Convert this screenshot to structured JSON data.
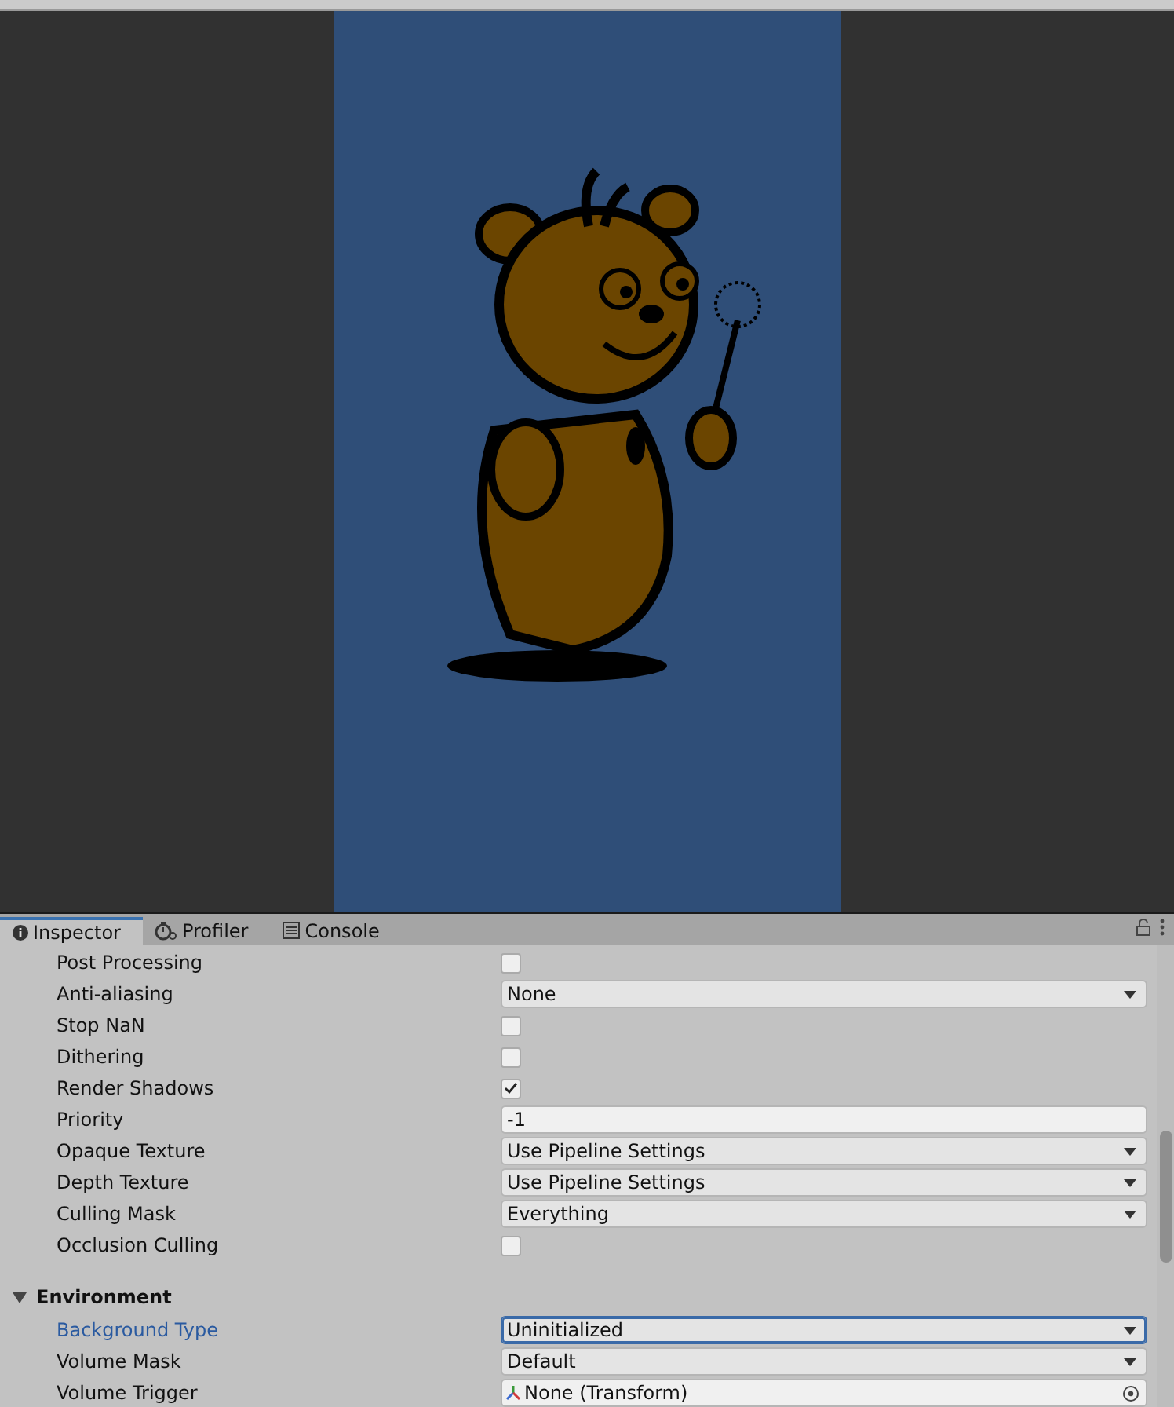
{
  "tabs": [
    {
      "label": "Inspector",
      "selected": true
    },
    {
      "label": "Profiler",
      "selected": false
    },
    {
      "label": "Console",
      "selected": false
    }
  ],
  "rows": [
    {
      "kind": "checkbox",
      "label": "Post Processing",
      "checked": false,
      "focused": false
    },
    {
      "kind": "dropdown",
      "label": "Anti-aliasing",
      "value": "None",
      "focused": false
    },
    {
      "kind": "checkbox",
      "label": "Stop NaN",
      "checked": false,
      "focused": false
    },
    {
      "kind": "checkbox",
      "label": "Dithering",
      "checked": false,
      "focused": false
    },
    {
      "kind": "checkbox",
      "label": "Render Shadows",
      "checked": true,
      "focused": false
    },
    {
      "kind": "text",
      "label": "Priority",
      "value": "-1",
      "focused": false
    },
    {
      "kind": "dropdown",
      "label": "Opaque Texture",
      "value": "Use Pipeline Settings",
      "focused": false
    },
    {
      "kind": "dropdown",
      "label": "Depth Texture",
      "value": "Use Pipeline Settings",
      "focused": false
    },
    {
      "kind": "dropdown",
      "label": "Culling Mask",
      "value": "Everything",
      "focused": false
    },
    {
      "kind": "checkbox",
      "label": "Occlusion Culling",
      "checked": false,
      "focused": false
    },
    {
      "kind": "header",
      "label": "Environment",
      "expanded": true
    },
    {
      "kind": "dropdown",
      "label": "Background Type",
      "value": "Uninitialized",
      "focused": true
    },
    {
      "kind": "dropdown",
      "label": "Volume Mask",
      "value": "Default",
      "focused": false
    },
    {
      "kind": "object",
      "label": "Volume Trigger",
      "value": "None (Transform)",
      "focused": false
    }
  ]
}
